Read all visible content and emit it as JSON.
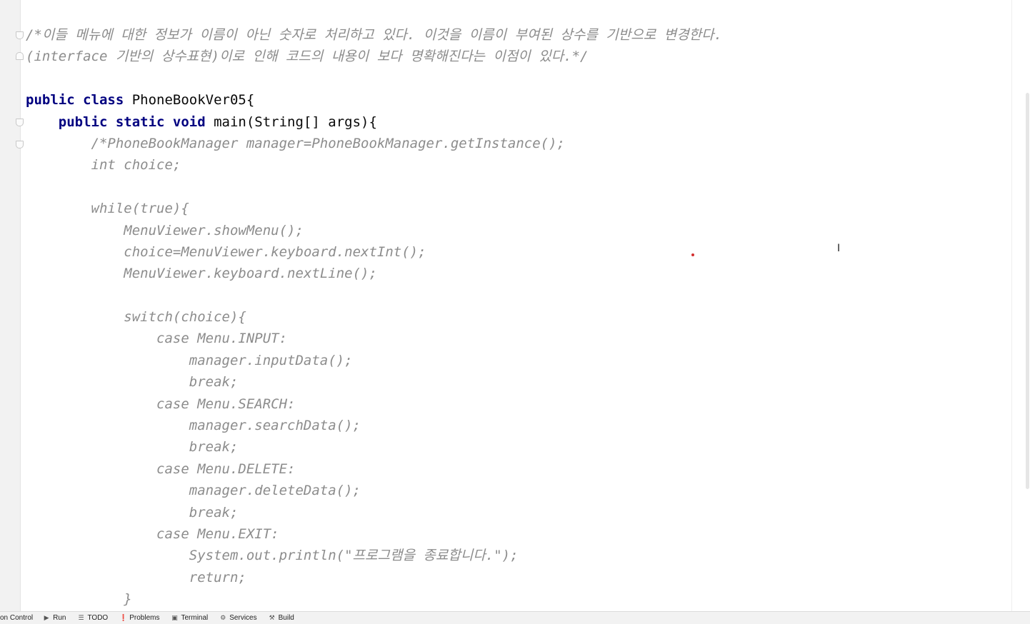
{
  "editor": {
    "lines": [
      {
        "indent": "",
        "parts": [
          {
            "style": "cmt",
            "text": "/*이들 메뉴에 대한 정보가 이름이 아닌 숫자로 처리하고 있다. 이것을 이름이 부여된 상수를 기반으로 변경한다."
          }
        ]
      },
      {
        "indent": "",
        "parts": [
          {
            "style": "cmt",
            "text": "(interface 기반의 상수표현)이로 인해 코드의 내용이 보다 명확해진다는 이점이 있다.*/"
          }
        ]
      },
      {
        "indent": "",
        "parts": []
      },
      {
        "indent": "",
        "parts": [
          {
            "style": "kw2",
            "text": "public class "
          },
          {
            "style": "plain",
            "text": "PhoneBookVer05{"
          }
        ]
      },
      {
        "indent": "    ",
        "parts": [
          {
            "style": "kw2",
            "text": "public static void "
          },
          {
            "style": "plain",
            "text": "main(String[] args){"
          }
        ]
      },
      {
        "indent": "        ",
        "parts": [
          {
            "style": "cmt",
            "text": "/*PhoneBookManager manager=PhoneBookManager.getInstance();"
          }
        ]
      },
      {
        "indent": "        ",
        "parts": [
          {
            "style": "cmt",
            "text": "int choice;"
          }
        ]
      },
      {
        "indent": "",
        "parts": []
      },
      {
        "indent": "        ",
        "parts": [
          {
            "style": "cmt",
            "text": "while(true){"
          }
        ]
      },
      {
        "indent": "            ",
        "parts": [
          {
            "style": "cmt",
            "text": "MenuViewer.showMenu();"
          }
        ]
      },
      {
        "indent": "            ",
        "parts": [
          {
            "style": "cmt",
            "text": "choice=MenuViewer.keyboard.nextInt();"
          }
        ]
      },
      {
        "indent": "            ",
        "parts": [
          {
            "style": "cmt",
            "text": "MenuViewer.keyboard.nextLine();"
          }
        ]
      },
      {
        "indent": "",
        "parts": []
      },
      {
        "indent": "            ",
        "parts": [
          {
            "style": "cmt",
            "text": "switch(choice){"
          }
        ]
      },
      {
        "indent": "                ",
        "parts": [
          {
            "style": "cmt",
            "text": "case Menu.INPUT:"
          }
        ]
      },
      {
        "indent": "                    ",
        "parts": [
          {
            "style": "cmt",
            "text": "manager.inputData();"
          }
        ]
      },
      {
        "indent": "                    ",
        "parts": [
          {
            "style": "cmt",
            "text": "break;"
          }
        ]
      },
      {
        "indent": "                ",
        "parts": [
          {
            "style": "cmt",
            "text": "case Menu.SEARCH:"
          }
        ]
      },
      {
        "indent": "                    ",
        "parts": [
          {
            "style": "cmt",
            "text": "manager.searchData();"
          }
        ]
      },
      {
        "indent": "                    ",
        "parts": [
          {
            "style": "cmt",
            "text": "break;"
          }
        ]
      },
      {
        "indent": "                ",
        "parts": [
          {
            "style": "cmt",
            "text": "case Menu.DELETE:"
          }
        ]
      },
      {
        "indent": "                    ",
        "parts": [
          {
            "style": "cmt",
            "text": "manager.deleteData();"
          }
        ]
      },
      {
        "indent": "                    ",
        "parts": [
          {
            "style": "cmt",
            "text": "break;"
          }
        ]
      },
      {
        "indent": "                ",
        "parts": [
          {
            "style": "cmt",
            "text": "case Menu.EXIT:"
          }
        ]
      },
      {
        "indent": "                    ",
        "parts": [
          {
            "style": "cmt",
            "text": "System.out.println(\"프로그램을 종료합니다.\");"
          }
        ]
      },
      {
        "indent": "                    ",
        "parts": [
          {
            "style": "cmt",
            "text": "return;"
          }
        ]
      },
      {
        "indent": "            ",
        "parts": [
          {
            "style": "cmt",
            "text": "}"
          }
        ]
      }
    ]
  },
  "statusbar": {
    "items": [
      {
        "name": "version-control",
        "icon": "",
        "label": "on Control"
      },
      {
        "name": "run",
        "icon": "play-icon",
        "label": "Run"
      },
      {
        "name": "todo",
        "icon": "list-icon",
        "label": "TODO"
      },
      {
        "name": "problems",
        "icon": "warning-icon",
        "label": "Problems"
      },
      {
        "name": "terminal",
        "icon": "terminal-icon",
        "label": "Terminal"
      },
      {
        "name": "services",
        "icon": "services-icon",
        "label": "Services"
      },
      {
        "name": "build",
        "icon": "hammer-icon",
        "label": "Build"
      }
    ]
  },
  "colors": {
    "keyword": "#000080",
    "comment": "#8c8c8c",
    "text": "#080808",
    "marker": "#d32f2f"
  }
}
